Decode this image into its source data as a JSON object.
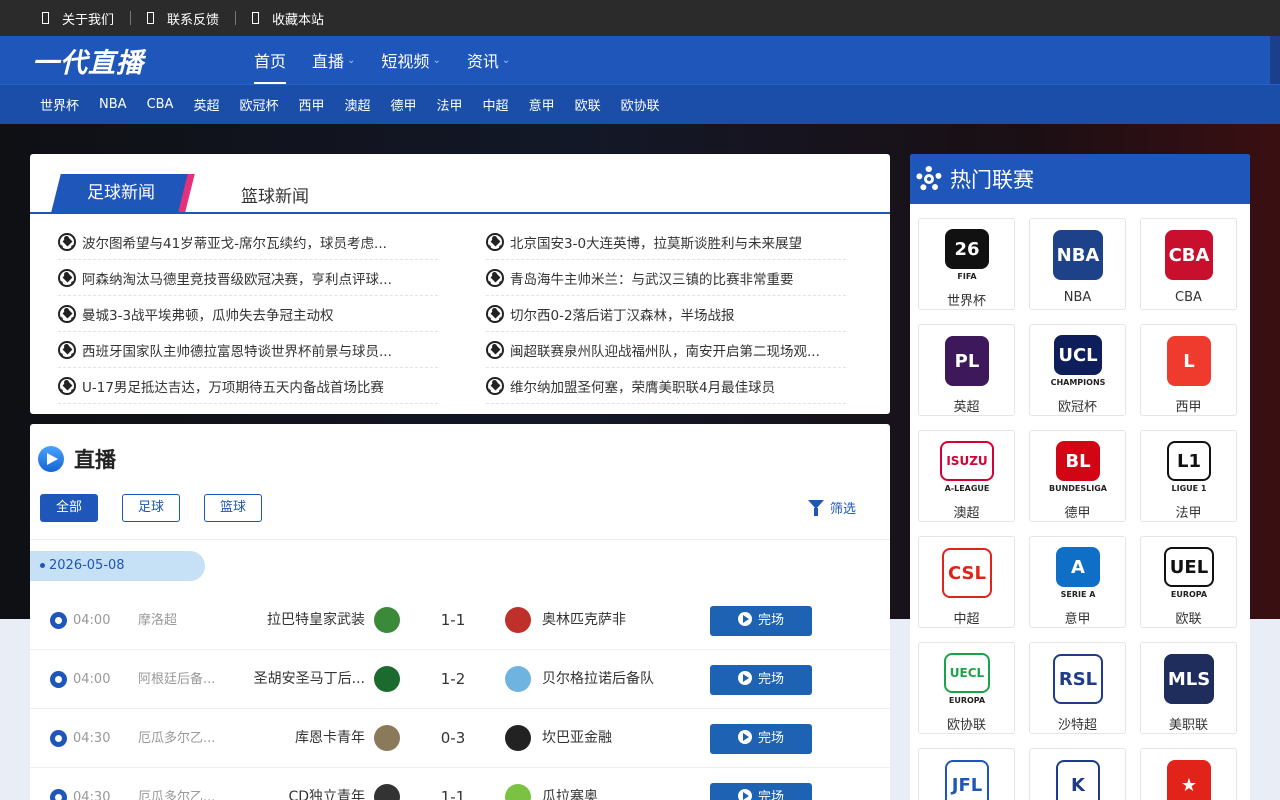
{
  "topbar": {
    "links": [
      "关于我们",
      "联系反馈",
      "收藏本站"
    ]
  },
  "header": {
    "logo": "一代直播",
    "nav": [
      {
        "label": "首页",
        "active": true,
        "dropdown": false
      },
      {
        "label": "直播",
        "active": false,
        "dropdown": true
      },
      {
        "label": "短视频",
        "active": false,
        "dropdown": true
      },
      {
        "label": "资讯",
        "active": false,
        "dropdown": true
      }
    ],
    "dropdown_glyph": "⌄"
  },
  "subnav": [
    "世界杯",
    "NBA",
    "CBA",
    "英超",
    "欧冠杯",
    "西甲",
    "澳超",
    "德甲",
    "法甲",
    "中超",
    "意甲",
    "欧联",
    "欧协联"
  ],
  "news": {
    "tabs": [
      "足球新闻",
      "篮球新闻"
    ],
    "left": [
      "波尔图希望与41岁蒂亚戈-席尔瓦续约，球员考虑...",
      "阿森纳淘汰马德里竞技晋级欧冠决赛，亨利点评球...",
      "曼城3-3战平埃弗顿，瓜帅失去争冠主动权",
      "西班牙国家队主帅德拉富恩特谈世界杯前景与球员...",
      "U-17男足抵达吉达，万项期待五天内备战首场比赛"
    ],
    "right": [
      "北京国安3-0大连英博，拉莫斯谈胜利与未来展望",
      "青岛海牛主帅米兰：与武汉三镇的比赛非常重要",
      "切尔西0-2落后诺丁汉森林，半场战报",
      "闽超联赛泉州队迎战福州队，南安开启第二现场观...",
      "维尔纳加盟圣何塞，荣膺美职联4月最佳球员"
    ]
  },
  "live": {
    "title": "直播",
    "filters": [
      "全部",
      "足球",
      "篮球"
    ],
    "filter_action": "筛选",
    "date": "2026-05-08",
    "matches": [
      {
        "time": "04:00",
        "league": "摩洛超",
        "home": "拉巴特皇家武装",
        "score": "1-1",
        "away": "奥林匹克萨非",
        "status": "完场",
        "home_color": "#3a8a3a",
        "away_color": "#c0302a"
      },
      {
        "time": "04:00",
        "league": "阿根廷后备...",
        "home": "圣胡安圣马丁后...",
        "score": "1-2",
        "away": "贝尔格拉诺后备队",
        "status": "完场",
        "home_color": "#1c6b2e",
        "away_color": "#6fb4e0"
      },
      {
        "time": "04:30",
        "league": "厄瓜多尔乙...",
        "home": "库恩卡青年",
        "score": "0-3",
        "away": "坎巴亚金融",
        "status": "完场",
        "home_color": "#8a7a5a",
        "away_color": "#222222"
      },
      {
        "time": "04:30",
        "league": "厄瓜多尔乙...",
        "home": "CD独立青年",
        "score": "1-1",
        "away": "瓜拉塞奥",
        "status": "完场",
        "home_color": "#333333",
        "away_color": "#7cc242"
      }
    ]
  },
  "hot_leagues": {
    "title": "热门联赛",
    "items": [
      {
        "name": "世界杯",
        "badge": "26",
        "sub": "FIFA",
        "color": "#111111",
        "fg": "#ffffff"
      },
      {
        "name": "NBA",
        "badge": "NBA",
        "sub": "",
        "color": "#1d428a",
        "fg": "#ffffff"
      },
      {
        "name": "CBA",
        "badge": "CBA",
        "sub": "",
        "color": "#c8102e",
        "fg": "#ffffff"
      },
      {
        "name": "英超",
        "badge": "PL",
        "sub": "",
        "color": "#3d195b",
        "fg": "#ffffff"
      },
      {
        "name": "欧冠杯",
        "badge": "UCL",
        "sub": "CHAMPIONS",
        "color": "#0e1e5b",
        "fg": "#ffffff"
      },
      {
        "name": "西甲",
        "badge": "L",
        "sub": "",
        "color": "#ee3b2d",
        "fg": "#ffffff"
      },
      {
        "name": "澳超",
        "badge": "ISUZU",
        "sub": "A-LEAGUE",
        "color": "#ffffff",
        "fg": "#d50032"
      },
      {
        "name": "德甲",
        "badge": "BL",
        "sub": "BUNDESLIGA",
        "color": "#d20515",
        "fg": "#ffffff"
      },
      {
        "name": "法甲",
        "badge": "L1",
        "sub": "LIGUE 1",
        "color": "#ffffff",
        "fg": "#111111"
      },
      {
        "name": "中超",
        "badge": "CSL",
        "sub": "",
        "color": "#ffffff",
        "fg": "#e2231a"
      },
      {
        "name": "意甲",
        "badge": "A",
        "sub": "SERIE A",
        "color": "#0f6fc6",
        "fg": "#ffffff"
      },
      {
        "name": "欧联",
        "badge": "UEL",
        "sub": "EUROPA",
        "color": "#ffffff",
        "fg": "#111111"
      },
      {
        "name": "欧协联",
        "badge": "UECL",
        "sub": "EUROPA",
        "color": "#ffffff",
        "fg": "#19a34a"
      },
      {
        "name": "沙特超",
        "badge": "RSL",
        "sub": "",
        "color": "#ffffff",
        "fg": "#1f3c88"
      },
      {
        "name": "美职联",
        "badge": "MLS",
        "sub": "",
        "color": "#1f2d5c",
        "fg": "#ffffff"
      },
      {
        "name": "",
        "badge": "JFL",
        "sub": "",
        "color": "#ffffff",
        "fg": "#1e56b9"
      },
      {
        "name": "",
        "badge": "K",
        "sub": "",
        "color": "#ffffff",
        "fg": "#1e3a8a"
      },
      {
        "name": "",
        "badge": "★",
        "sub": "",
        "color": "#e2231a",
        "fg": "#ffffff"
      }
    ]
  }
}
